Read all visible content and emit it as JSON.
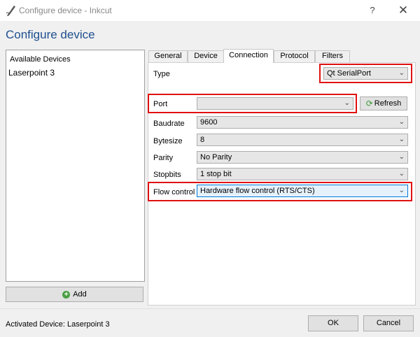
{
  "window": {
    "title": "Configure device - Inkcut",
    "help": "?",
    "close": "✕",
    "icon": "inkcut-pen-icon"
  },
  "heading": "Configure device",
  "devices": {
    "header": "Available Devices",
    "items": [
      "Laserpoint 3"
    ],
    "add_label": "Add"
  },
  "tabs": [
    "General",
    "Device",
    "Connection",
    "Protocol",
    "Filters"
  ],
  "active_tab": "Connection",
  "connection": {
    "type": {
      "label": "Type",
      "value": "Qt SerialPort"
    },
    "port": {
      "label": "Port",
      "value": ""
    },
    "refresh_label": "Refresh",
    "baudrate": {
      "label": "Baudrate",
      "value": "9600"
    },
    "bytesize": {
      "label": "Bytesize",
      "value": "8"
    },
    "parity": {
      "label": "Parity",
      "value": "No Parity"
    },
    "stopbits": {
      "label": "Stopbits",
      "value": "1 stop bit"
    },
    "flow_control": {
      "label": "Flow control",
      "value": "Hardware flow control (RTS/CTS)"
    }
  },
  "status": "Activated Device: Laserpoint 3",
  "buttons": {
    "ok": "OK",
    "cancel": "Cancel"
  },
  "colors": {
    "highlight": "#e01010",
    "heading": "#1e4f8f"
  }
}
